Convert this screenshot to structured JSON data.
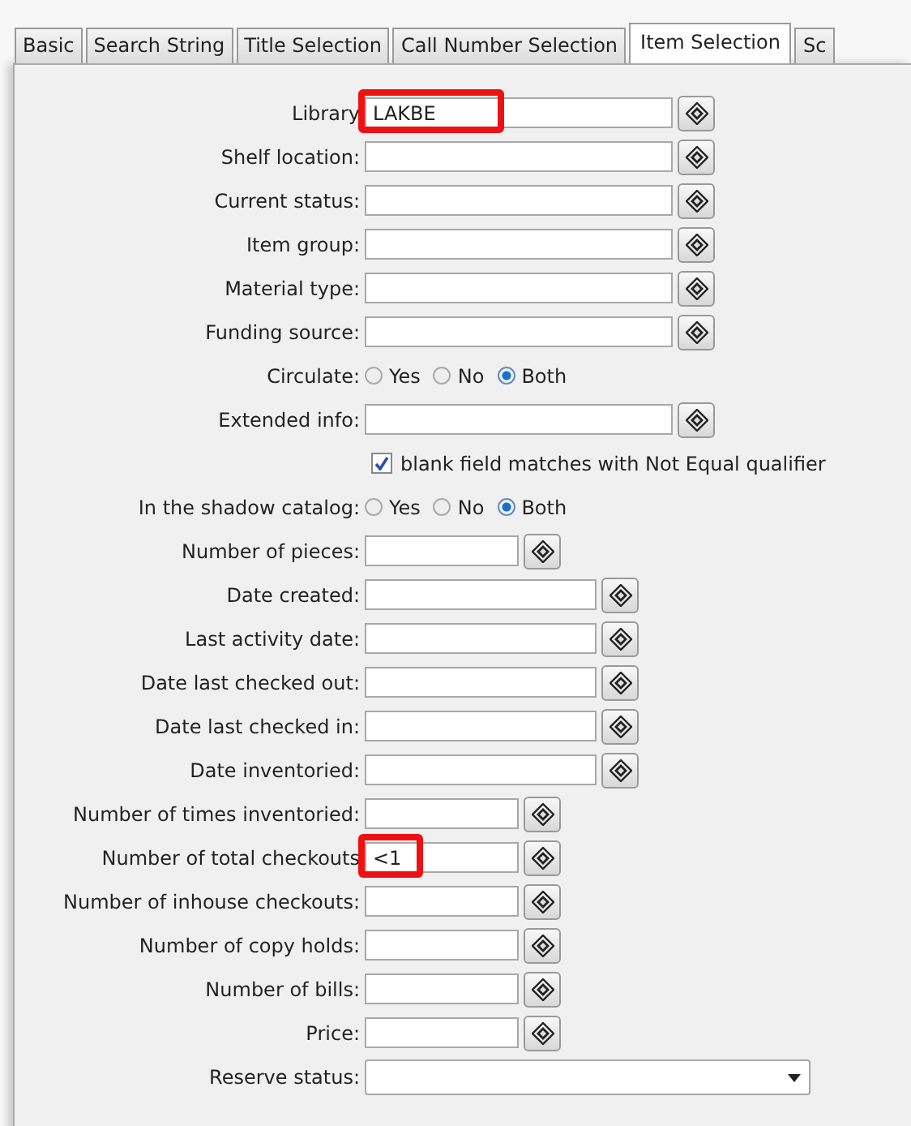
{
  "tabs": [
    {
      "label": "Basic",
      "selected": false
    },
    {
      "label": "Search String",
      "selected": false
    },
    {
      "label": "Title Selection",
      "selected": false
    },
    {
      "label": "Call Number Selection",
      "selected": false
    },
    {
      "label": "Item Selection",
      "selected": true
    },
    {
      "label": "Sc",
      "selected": false
    }
  ],
  "rows": [
    {
      "kind": "long_field",
      "label": "Library",
      "value": "LAKBE",
      "highlighted": true
    },
    {
      "kind": "long_field",
      "label": "Shelf location:",
      "highlighted": false
    },
    {
      "kind": "long_field",
      "label": "Current status:",
      "highlighted": false
    },
    {
      "kind": "long_field",
      "label": "Item group:",
      "highlighted": false
    },
    {
      "kind": "long_field",
      "label": "Material type:",
      "highlighted": false
    },
    {
      "kind": "long_field",
      "label": "Funding source:",
      "highlighted": false
    },
    {
      "kind": "radio",
      "label": "Circulate:",
      "options": [
        {
          "label": "Yes",
          "selected": false
        },
        {
          "label": "No",
          "selected": false
        },
        {
          "label": "Both",
          "selected": true
        }
      ]
    },
    {
      "kind": "long_field",
      "label": "Extended info:",
      "highlighted": false
    },
    {
      "kind": "checkbox",
      "text": "blank field matches with Not Equal qualifier",
      "checked": true
    },
    {
      "kind": "radio",
      "label": "In the shadow catalog:",
      "options": [
        {
          "label": "Yes",
          "selected": false
        },
        {
          "label": "No",
          "selected": false
        },
        {
          "label": "Both",
          "selected": true
        }
      ]
    },
    {
      "kind": "short_field",
      "label": "Number of pieces:",
      "highlighted": false
    },
    {
      "kind": "medium_field",
      "label": "Date created:",
      "highlighted": false
    },
    {
      "kind": "medium_field",
      "label": "Last activity date:",
      "highlighted": false
    },
    {
      "kind": "medium_field",
      "label": "Date last checked out:",
      "highlighted": false
    },
    {
      "kind": "medium_field",
      "label": "Date last checked in:",
      "highlighted": false
    },
    {
      "kind": "medium_field",
      "label": "Date inventoried:",
      "highlighted": false
    },
    {
      "kind": "short_field",
      "label": "Number of times inventoried:",
      "highlighted": false
    },
    {
      "kind": "short_field",
      "label": "Number of total checkouts",
      "value": "<1",
      "highlighted": true
    },
    {
      "kind": "short_field",
      "label": "Number of inhouse checkouts:",
      "highlighted": false
    },
    {
      "kind": "short_field",
      "label": "Number of copy holds:",
      "highlighted": false
    },
    {
      "kind": "short_field",
      "label": "Number of bills:",
      "highlighted": false
    },
    {
      "kind": "short_field",
      "label": "Price:",
      "highlighted": false
    },
    {
      "kind": "dropdown",
      "label": "Reserve status:"
    }
  ]
}
